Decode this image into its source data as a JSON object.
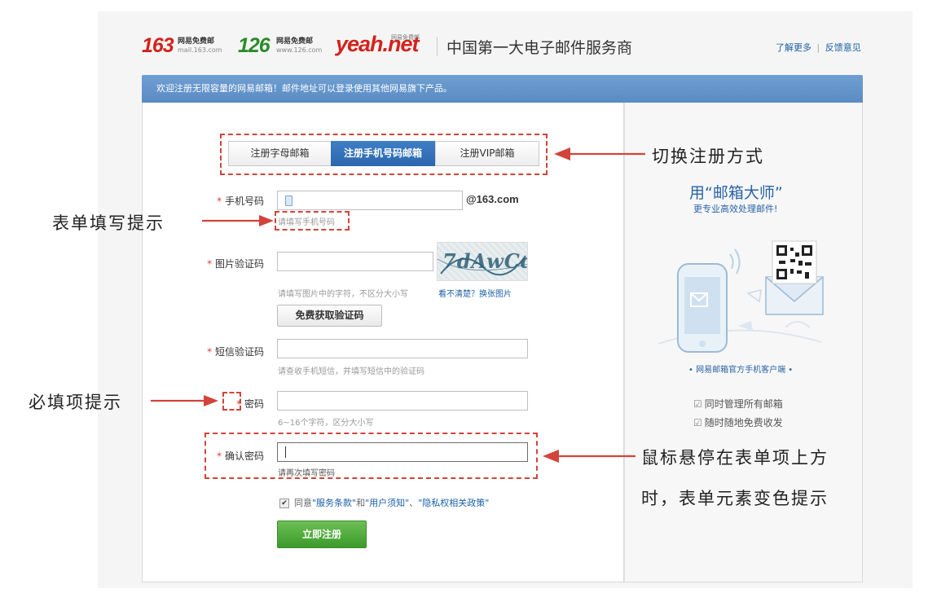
{
  "header": {
    "logos": [
      {
        "num": "163",
        "line1": "网易免费邮",
        "line2": "mail.163.com"
      },
      {
        "num": "126",
        "line1": "网易免费邮",
        "line2": "www.126.com"
      },
      {
        "num": "yeah.net",
        "line1": "网易免费邮",
        "line2": ""
      }
    ],
    "slogan": "中国第一大电子邮件服务商",
    "link_more": "了解更多",
    "link_sep": "|",
    "link_feedback": "反馈意见",
    "colors": {
      "red": "#d3221b",
      "green": "#2a8b2a"
    }
  },
  "banner": {
    "text": "欢迎注册无限容量的网易邮箱！邮件地址可以登录使用其他网易旗下产品。"
  },
  "tabs": [
    {
      "label": "注册字母邮箱",
      "active": false
    },
    {
      "label": "注册手机号码邮箱",
      "active": true
    },
    {
      "label": "注册VIP邮箱",
      "active": false
    }
  ],
  "form": {
    "required_mark": "*",
    "phone": {
      "label": "手机号码",
      "suffix": "@163.com",
      "hint": "请填写手机号码"
    },
    "captcha": {
      "label": "图片验证码",
      "hint": "请填写图片中的字符，不区分大小写",
      "refresh": "看不清楚？换张图片",
      "image_text": "7dAwCd"
    },
    "get_code_button": "免费获取验证码",
    "sms": {
      "label": "短信验证码",
      "hint": "请查收手机短信，并填写短信中的验证码"
    },
    "password": {
      "label": "密码",
      "hint": "6~16个字符，区分大小写"
    },
    "confirm": {
      "label": "确认密码",
      "hint": "请再次填写密码"
    },
    "agree": {
      "pre": "同意",
      "terms": "\"服务条款\"",
      "and": "和",
      "notice": "\"用户须知\"",
      "comma": "、",
      "privacy": "\"隐私权相关政策\""
    },
    "submit": "立即注册"
  },
  "sidebar": {
    "title": "用“邮箱大师”",
    "subtitle": "更专业高效处理邮件!",
    "caption": "• 网易邮箱官方手机客户端 •",
    "features": [
      "同时管理所有邮箱",
      "随时随地免费收发"
    ]
  },
  "annotations": {
    "switch": "切换注册方式",
    "form_hint": "表单填写提示",
    "required_hint": "必填项提示",
    "hover_line1": "鼠标悬停在表单项上方",
    "hover_line2": "时，表单元素变色提示",
    "color": "#d2443b"
  }
}
